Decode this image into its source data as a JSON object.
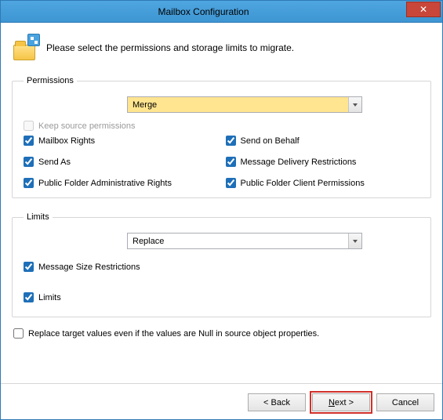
{
  "window": {
    "title": "Mailbox Configuration"
  },
  "intro": {
    "text": "Please select the permissions and storage limits to migrate."
  },
  "permissions": {
    "legend": "Permissions",
    "mode": "Merge",
    "keep_source_label": "Keep source permissions",
    "keep_source_checked": false,
    "keep_source_disabled": true,
    "items": {
      "mailbox_rights": {
        "label": "Mailbox Rights",
        "checked": true
      },
      "send_on_behalf": {
        "label": "Send on Behalf",
        "checked": true
      },
      "send_as": {
        "label": "Send As",
        "checked": true
      },
      "msg_delivery": {
        "label": "Message Delivery Restrictions",
        "checked": true
      },
      "pf_admin_rights": {
        "label": "Public Folder Administrative Rights",
        "checked": true
      },
      "pf_client_perms": {
        "label": "Public Folder Client Permissions",
        "checked": true
      }
    }
  },
  "limits": {
    "legend": "Limits",
    "mode": "Replace",
    "items": {
      "msg_size": {
        "label": "Message Size Restrictions",
        "checked": true
      },
      "limits": {
        "label": "Limits",
        "checked": true
      }
    }
  },
  "replace_null": {
    "label": "Replace target values even if the values are Null in source object properties.",
    "checked": false
  },
  "buttons": {
    "back": "< Back",
    "next": "Next >",
    "cancel": "Cancel"
  }
}
